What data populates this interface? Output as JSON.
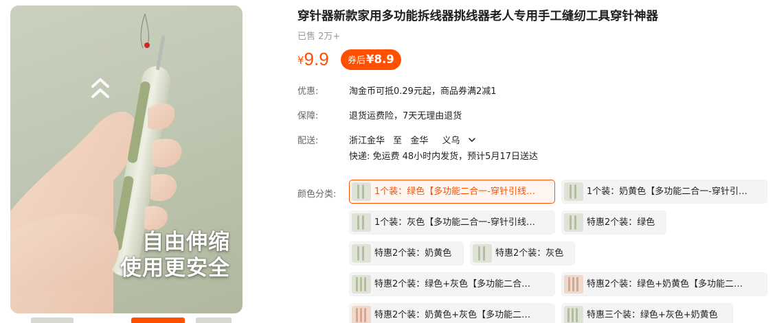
{
  "product": {
    "title": "穿针器新款家用多功能拆线器挑线器老人专用手工缝纫工具穿针神器",
    "sold": "已售 2万+",
    "image_caption_line1": "自由伸缩",
    "image_caption_line2": "使用更安全"
  },
  "price": {
    "currency": "¥",
    "value": "9.9",
    "coupon_prefix": "券后",
    "coupon_value": "¥8.9"
  },
  "promo": {
    "label": "优惠:",
    "text": "淘金币可抵0.29元起，商品券满2减1"
  },
  "guarantee": {
    "label": "保障:",
    "text": "退货运费险，7天无理由退货"
  },
  "delivery": {
    "label": "配送:",
    "from": "浙江金华",
    "to_word": "至",
    "to_city": "金华",
    "to_district": "义乌",
    "express": "快递: 免运费  48小时内发货，预计5月17日送达"
  },
  "sku": {
    "label": "颜色分类:",
    "options": [
      "1个装：绿色【多功能二合一-穿针引线…",
      "1个装：奶黄色【多功能二合一-穿针引…",
      "1个装：灰色【多功能二合一-穿针引线…",
      "特惠2个装：绿色",
      "特惠2个装：奶黄色",
      "特惠2个装：灰色",
      "特惠2个装：绿色+灰色【多功能二合…",
      "特惠2个装：绿色+奶黄色【多功能二…",
      "特惠2个装：奶黄色+灰色【多功能二…",
      "特惠三个装：绿色+灰色+奶黄色"
    ],
    "selected_index": 0
  },
  "colors": {
    "accent": "#ff5000",
    "muted_text": "#999999",
    "label_text": "#666666",
    "image_bg": "#c4caB6"
  },
  "icons": {
    "delivery_dropdown": "chevron-down-icon",
    "image_overlay": "double-chevron-up-icon"
  }
}
